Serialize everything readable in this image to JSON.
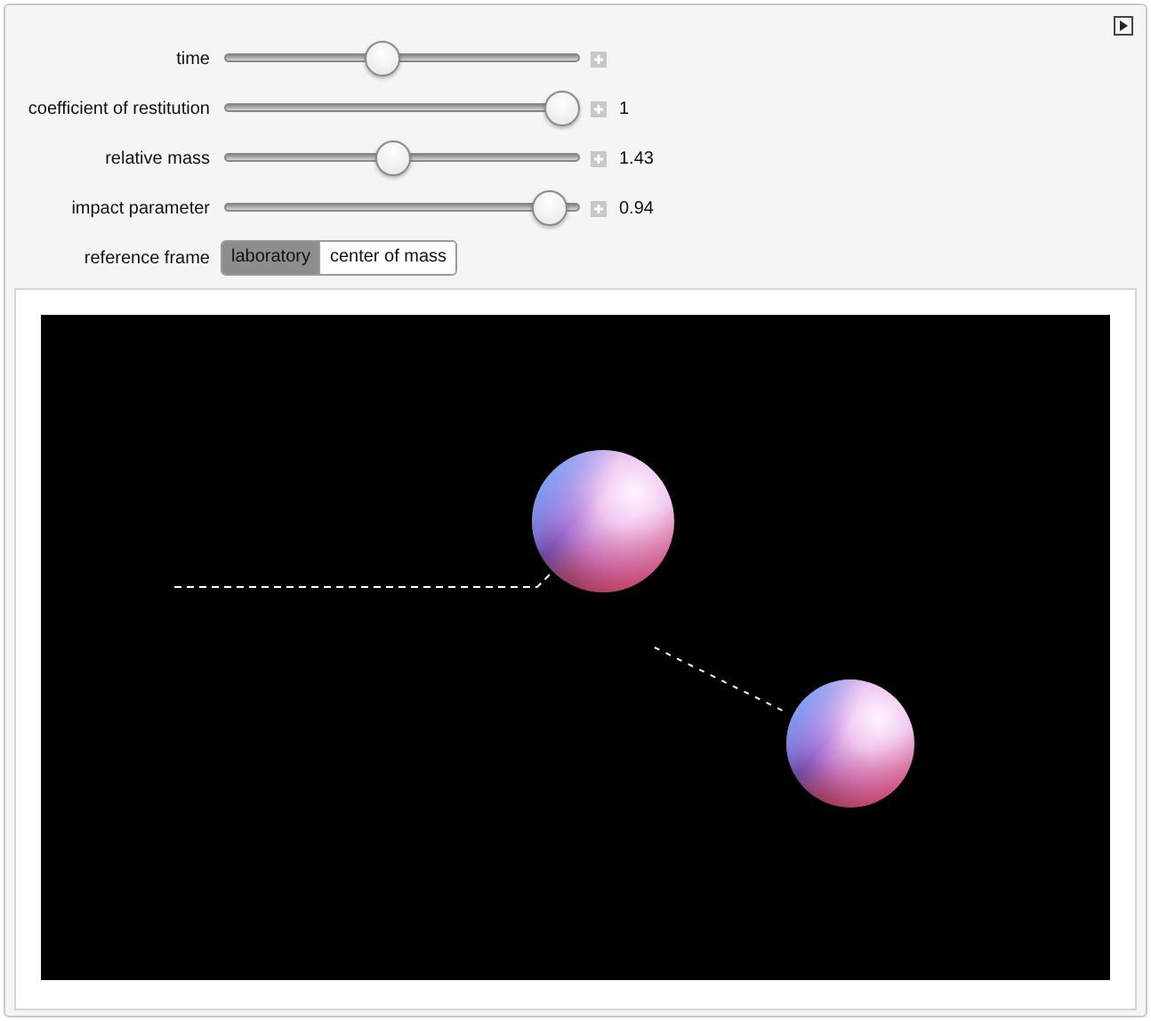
{
  "controls": [
    {
      "label": "time",
      "level": 0.44
    },
    {
      "label": "coefficient of restitution",
      "level": 1.0,
      "reading": "1"
    },
    {
      "label": "relative mass",
      "level": 0.47,
      "reading": "1.43"
    },
    {
      "label": "impact parameter",
      "level": 0.96,
      "reading": "0.94"
    }
  ],
  "reference_frame": {
    "label": "reference frame",
    "options": [
      {
        "label": "laboratory",
        "selected": true
      },
      {
        "label": "center of mass",
        "selected": false
      }
    ]
  }
}
